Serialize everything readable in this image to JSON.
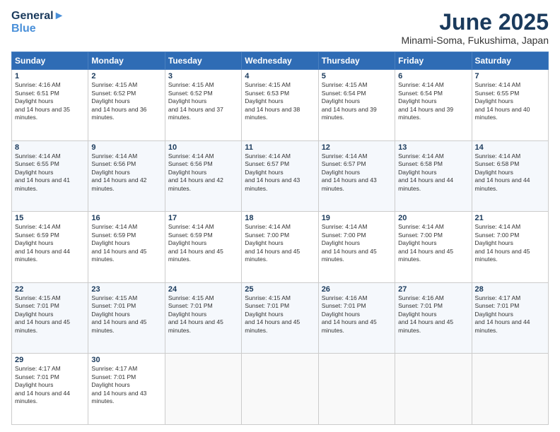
{
  "logo": {
    "line1": "General",
    "line2": "Blue"
  },
  "title": "June 2025",
  "subtitle": "Minami-Soma, Fukushima, Japan",
  "days_of_week": [
    "Sunday",
    "Monday",
    "Tuesday",
    "Wednesday",
    "Thursday",
    "Friday",
    "Saturday"
  ],
  "weeks": [
    [
      {
        "day": 1,
        "sunrise": "4:16 AM",
        "sunset": "6:51 PM",
        "daylight": "14 hours and 35 minutes."
      },
      {
        "day": 2,
        "sunrise": "4:15 AM",
        "sunset": "6:52 PM",
        "daylight": "14 hours and 36 minutes."
      },
      {
        "day": 3,
        "sunrise": "4:15 AM",
        "sunset": "6:52 PM",
        "daylight": "14 hours and 37 minutes."
      },
      {
        "day": 4,
        "sunrise": "4:15 AM",
        "sunset": "6:53 PM",
        "daylight": "14 hours and 38 minutes."
      },
      {
        "day": 5,
        "sunrise": "4:15 AM",
        "sunset": "6:54 PM",
        "daylight": "14 hours and 39 minutes."
      },
      {
        "day": 6,
        "sunrise": "4:14 AM",
        "sunset": "6:54 PM",
        "daylight": "14 hours and 39 minutes."
      },
      {
        "day": 7,
        "sunrise": "4:14 AM",
        "sunset": "6:55 PM",
        "daylight": "14 hours and 40 minutes."
      }
    ],
    [
      {
        "day": 8,
        "sunrise": "4:14 AM",
        "sunset": "6:55 PM",
        "daylight": "14 hours and 41 minutes."
      },
      {
        "day": 9,
        "sunrise": "4:14 AM",
        "sunset": "6:56 PM",
        "daylight": "14 hours and 42 minutes."
      },
      {
        "day": 10,
        "sunrise": "4:14 AM",
        "sunset": "6:56 PM",
        "daylight": "14 hours and 42 minutes."
      },
      {
        "day": 11,
        "sunrise": "4:14 AM",
        "sunset": "6:57 PM",
        "daylight": "14 hours and 43 minutes."
      },
      {
        "day": 12,
        "sunrise": "4:14 AM",
        "sunset": "6:57 PM",
        "daylight": "14 hours and 43 minutes."
      },
      {
        "day": 13,
        "sunrise": "4:14 AM",
        "sunset": "6:58 PM",
        "daylight": "14 hours and 44 minutes."
      },
      {
        "day": 14,
        "sunrise": "4:14 AM",
        "sunset": "6:58 PM",
        "daylight": "14 hours and 44 minutes."
      }
    ],
    [
      {
        "day": 15,
        "sunrise": "4:14 AM",
        "sunset": "6:59 PM",
        "daylight": "14 hours and 44 minutes."
      },
      {
        "day": 16,
        "sunrise": "4:14 AM",
        "sunset": "6:59 PM",
        "daylight": "14 hours and 45 minutes."
      },
      {
        "day": 17,
        "sunrise": "4:14 AM",
        "sunset": "6:59 PM",
        "daylight": "14 hours and 45 minutes."
      },
      {
        "day": 18,
        "sunrise": "4:14 AM",
        "sunset": "7:00 PM",
        "daylight": "14 hours and 45 minutes."
      },
      {
        "day": 19,
        "sunrise": "4:14 AM",
        "sunset": "7:00 PM",
        "daylight": "14 hours and 45 minutes."
      },
      {
        "day": 20,
        "sunrise": "4:14 AM",
        "sunset": "7:00 PM",
        "daylight": "14 hours and 45 minutes."
      },
      {
        "day": 21,
        "sunrise": "4:14 AM",
        "sunset": "7:00 PM",
        "daylight": "14 hours and 45 minutes."
      }
    ],
    [
      {
        "day": 22,
        "sunrise": "4:15 AM",
        "sunset": "7:01 PM",
        "daylight": "14 hours and 45 minutes."
      },
      {
        "day": 23,
        "sunrise": "4:15 AM",
        "sunset": "7:01 PM",
        "daylight": "14 hours and 45 minutes."
      },
      {
        "day": 24,
        "sunrise": "4:15 AM",
        "sunset": "7:01 PM",
        "daylight": "14 hours and 45 minutes."
      },
      {
        "day": 25,
        "sunrise": "4:15 AM",
        "sunset": "7:01 PM",
        "daylight": "14 hours and 45 minutes."
      },
      {
        "day": 26,
        "sunrise": "4:16 AM",
        "sunset": "7:01 PM",
        "daylight": "14 hours and 45 minutes."
      },
      {
        "day": 27,
        "sunrise": "4:16 AM",
        "sunset": "7:01 PM",
        "daylight": "14 hours and 45 minutes."
      },
      {
        "day": 28,
        "sunrise": "4:17 AM",
        "sunset": "7:01 PM",
        "daylight": "14 hours and 44 minutes."
      }
    ],
    [
      {
        "day": 29,
        "sunrise": "4:17 AM",
        "sunset": "7:01 PM",
        "daylight": "14 hours and 44 minutes."
      },
      {
        "day": 30,
        "sunrise": "4:17 AM",
        "sunset": "7:01 PM",
        "daylight": "14 hours and 43 minutes."
      },
      null,
      null,
      null,
      null,
      null
    ]
  ]
}
